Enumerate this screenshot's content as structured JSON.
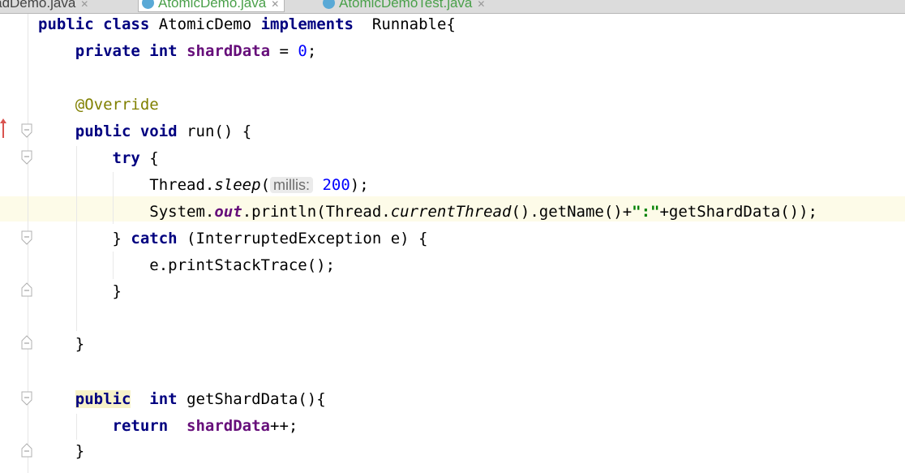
{
  "tabs": [
    {
      "label": "readDemo.java",
      "active": false
    },
    {
      "label": "AtomicDemo.java",
      "active": true
    },
    {
      "label": "AtomicDemoTest.java",
      "active": false
    }
  ],
  "code": {
    "l1": {
      "kw1": "public",
      "kw2": "class",
      "name": "AtomicDemo",
      "kw3": "implements",
      "iface": "Runnable{"
    },
    "l2": {
      "kw1": "private",
      "kw2": "int",
      "field": "shardData",
      "rest": " = ",
      "num": "0",
      "end": ";"
    },
    "l3": {
      "ann": "@Override"
    },
    "l4": {
      "kw1": "public",
      "kw2": "void",
      "rest": " run() {"
    },
    "l5": {
      "kw": "try",
      "rest": " {"
    },
    "l6": {
      "pre": "Thread.",
      "method": "sleep",
      "open": "(",
      "hint": "millis:",
      "num": "200",
      "end": ");"
    },
    "l7": {
      "pre": "System.",
      "field": "out",
      "mid": ".println(Thread.",
      "method": "currentThread",
      "mid2": "().getName()+",
      "str": "\":\"",
      "end": "+getShardData());"
    },
    "l8": {
      "pre": "} ",
      "kw": "catch",
      "rest": " (InterruptedException e) {"
    },
    "l9": {
      "text": "e.printStackTrace();"
    },
    "l10": {
      "text": "}"
    },
    "l11": {
      "text": "}"
    },
    "l12": {
      "kw1": "public",
      "kw2": "int",
      "rest": " getShardData(){"
    },
    "l13": {
      "kw": "return",
      "field": "shardData",
      "end": "++;"
    },
    "l14": {
      "text": "}"
    }
  },
  "icons": {
    "fold": "fold-marker-icon",
    "override": "override-marker-icon",
    "tab": "java-class-icon"
  }
}
